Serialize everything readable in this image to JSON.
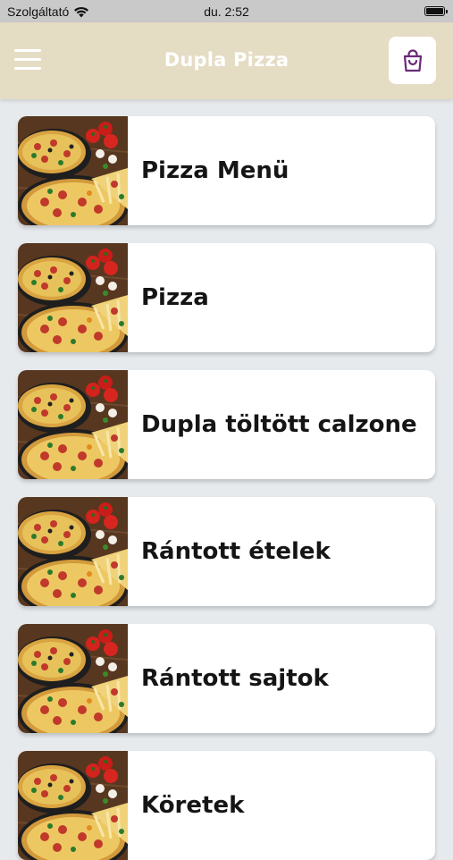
{
  "status_bar": {
    "carrier": "Szolgáltató",
    "time": "du. 2:52"
  },
  "header": {
    "title": "Dupla Pizza",
    "menu_icon": "hamburger-icon",
    "cart_icon": "shopping-bag-icon"
  },
  "colors": {
    "header_bg": "#e5dcc4",
    "page_bg": "#e7eaed",
    "accent": "#6b2a7a"
  },
  "categories": [
    {
      "label": "Pizza Menü"
    },
    {
      "label": "Pizza"
    },
    {
      "label": "Dupla töltött calzone"
    },
    {
      "label": "Rántott ételek"
    },
    {
      "label": "Rántott sajtok"
    },
    {
      "label": "Köretek"
    }
  ]
}
